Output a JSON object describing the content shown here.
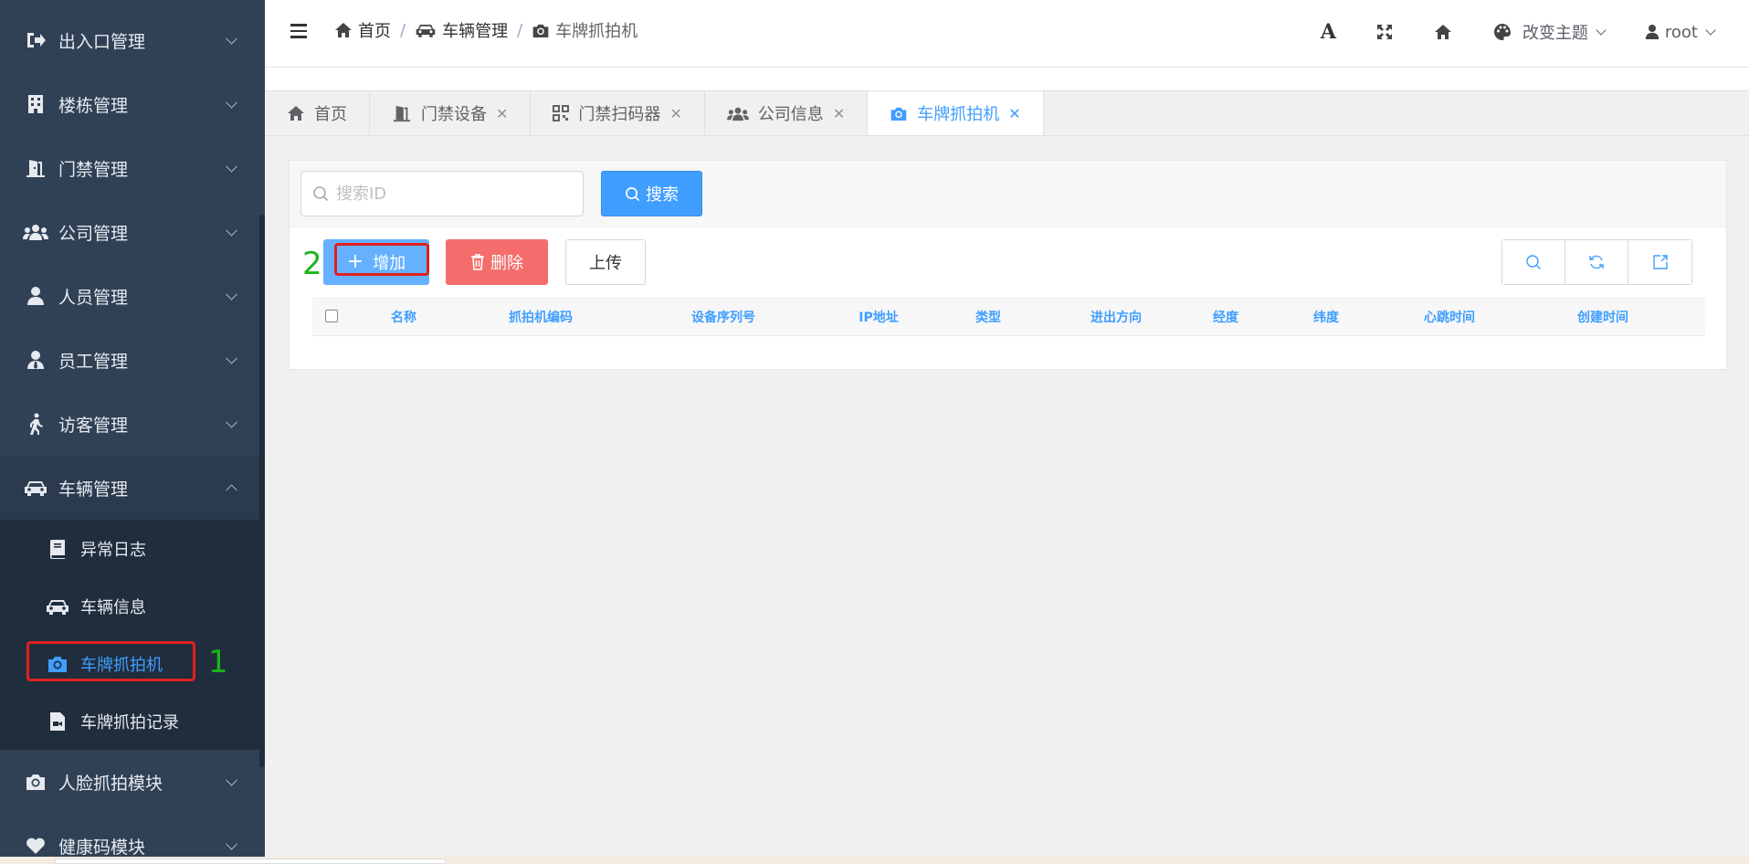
{
  "sidebar": {
    "items": [
      {
        "label": "出入口管理",
        "icon": "sign-out-icon"
      },
      {
        "label": "楼栋管理",
        "icon": "building-icon"
      },
      {
        "label": "门禁管理",
        "icon": "door-icon"
      },
      {
        "label": "公司管理",
        "icon": "users-icon"
      },
      {
        "label": "人员管理",
        "icon": "user-icon"
      },
      {
        "label": "员工管理",
        "icon": "user-tie-icon"
      },
      {
        "label": "访客管理",
        "icon": "walking-icon"
      },
      {
        "label": "车辆管理",
        "icon": "car-icon"
      }
    ],
    "sub_items": [
      {
        "label": "异常日志",
        "icon": "book-icon"
      },
      {
        "label": "车辆信息",
        "icon": "car-icon"
      },
      {
        "label": "车牌抓拍机",
        "icon": "camera-icon"
      },
      {
        "label": "车牌抓拍记录",
        "icon": "file-video-icon"
      }
    ],
    "bottom_items": [
      {
        "label": "人脸抓拍模块",
        "icon": "camera-icon"
      },
      {
        "label": "健康码模块",
        "icon": "heart-icon"
      }
    ]
  },
  "header": {
    "breadcrumb": [
      "首页",
      "车辆管理",
      "车牌抓拍机"
    ],
    "theme_label": "改变主题",
    "user_label": "root"
  },
  "tabs": [
    {
      "label": "首页",
      "closable": false
    },
    {
      "label": "门禁设备",
      "closable": true
    },
    {
      "label": "门禁扫码器",
      "closable": true
    },
    {
      "label": "公司信息",
      "closable": true
    },
    {
      "label": "车牌抓拍机",
      "closable": true,
      "active": true
    }
  ],
  "search": {
    "placeholder": "搜索ID",
    "button_label": "搜索"
  },
  "toolbar": {
    "add_label": "增加",
    "delete_label": "删除",
    "upload_label": "上传"
  },
  "annotations": {
    "step1": "1",
    "step2": "2"
  },
  "table": {
    "columns": [
      "名称",
      "抓拍机编码",
      "设备序列号",
      "IP地址",
      "类型",
      "进出方向",
      "经度",
      "纬度",
      "心跳时间",
      "创建时间"
    ]
  },
  "colors": {
    "sidebar_bg": "#304156",
    "submenu_bg": "#1f2d3d",
    "accent": "#409eff",
    "danger": "#f56c6c",
    "annotation_red": "#e02020",
    "annotation_green": "#1bb51b"
  }
}
